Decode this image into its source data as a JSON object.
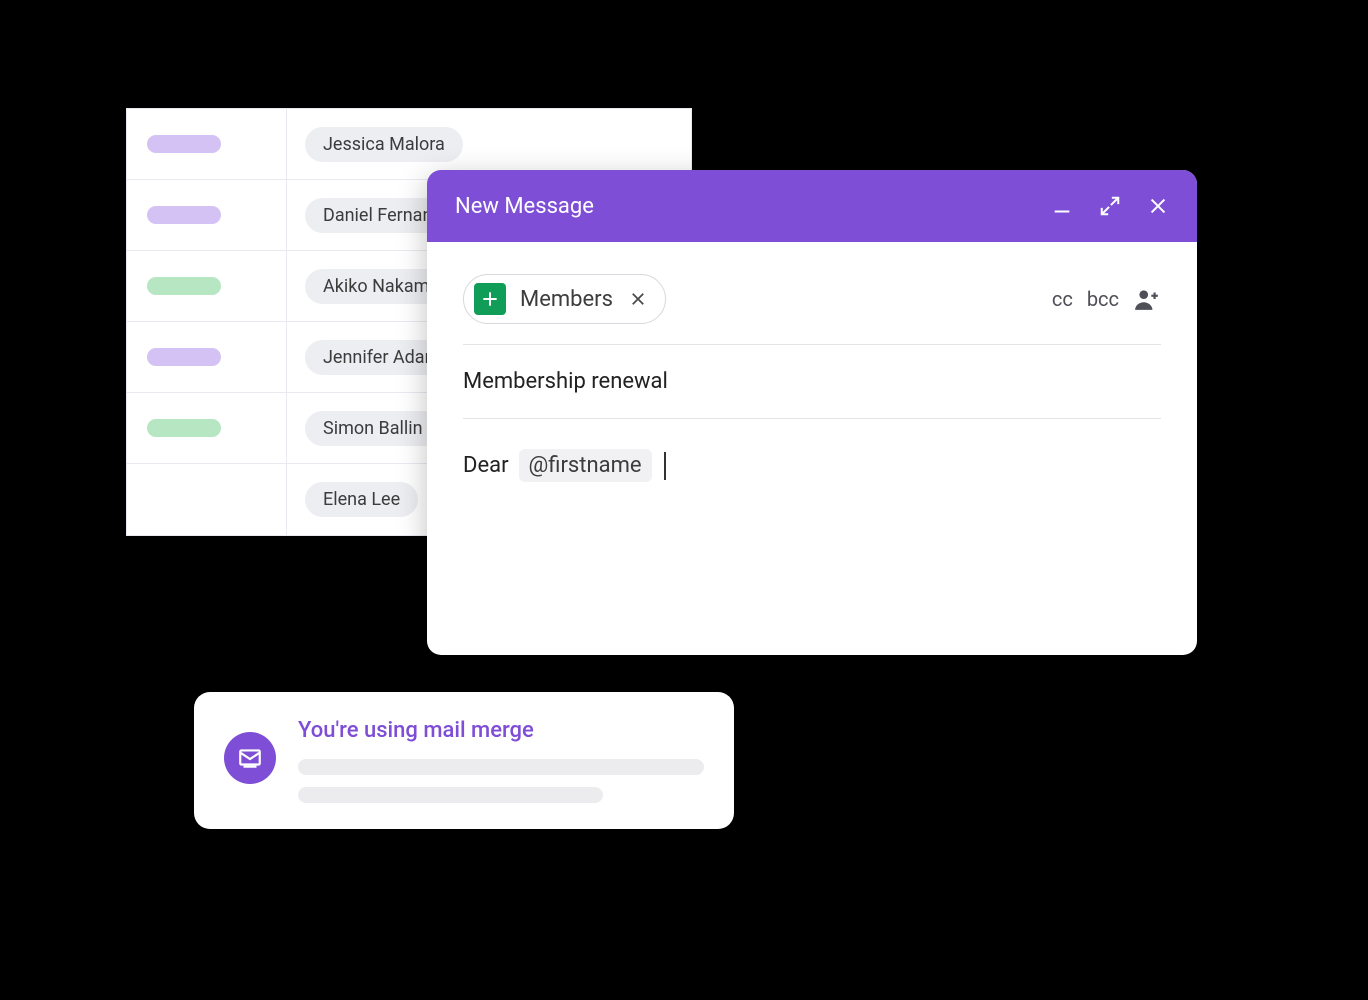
{
  "sheet": {
    "rows": [
      {
        "color": "purple",
        "name": "Jessica Malora"
      },
      {
        "color": "purple",
        "name": "Daniel Fernandez"
      },
      {
        "color": "green",
        "name": "Akiko Nakamura"
      },
      {
        "color": "purple",
        "name": "Jennifer Adams"
      },
      {
        "color": "green",
        "name": "Simon Ballin"
      },
      {
        "color": "",
        "name": "Elena Lee"
      }
    ]
  },
  "compose": {
    "title": "New Message",
    "recipient_chip": "Members",
    "cc_label": "cc",
    "bcc_label": "bcc",
    "subject": "Membership renewal",
    "body_greeting": "Dear",
    "merge_tag": "@firstname"
  },
  "toast": {
    "title": "You're using mail merge"
  }
}
